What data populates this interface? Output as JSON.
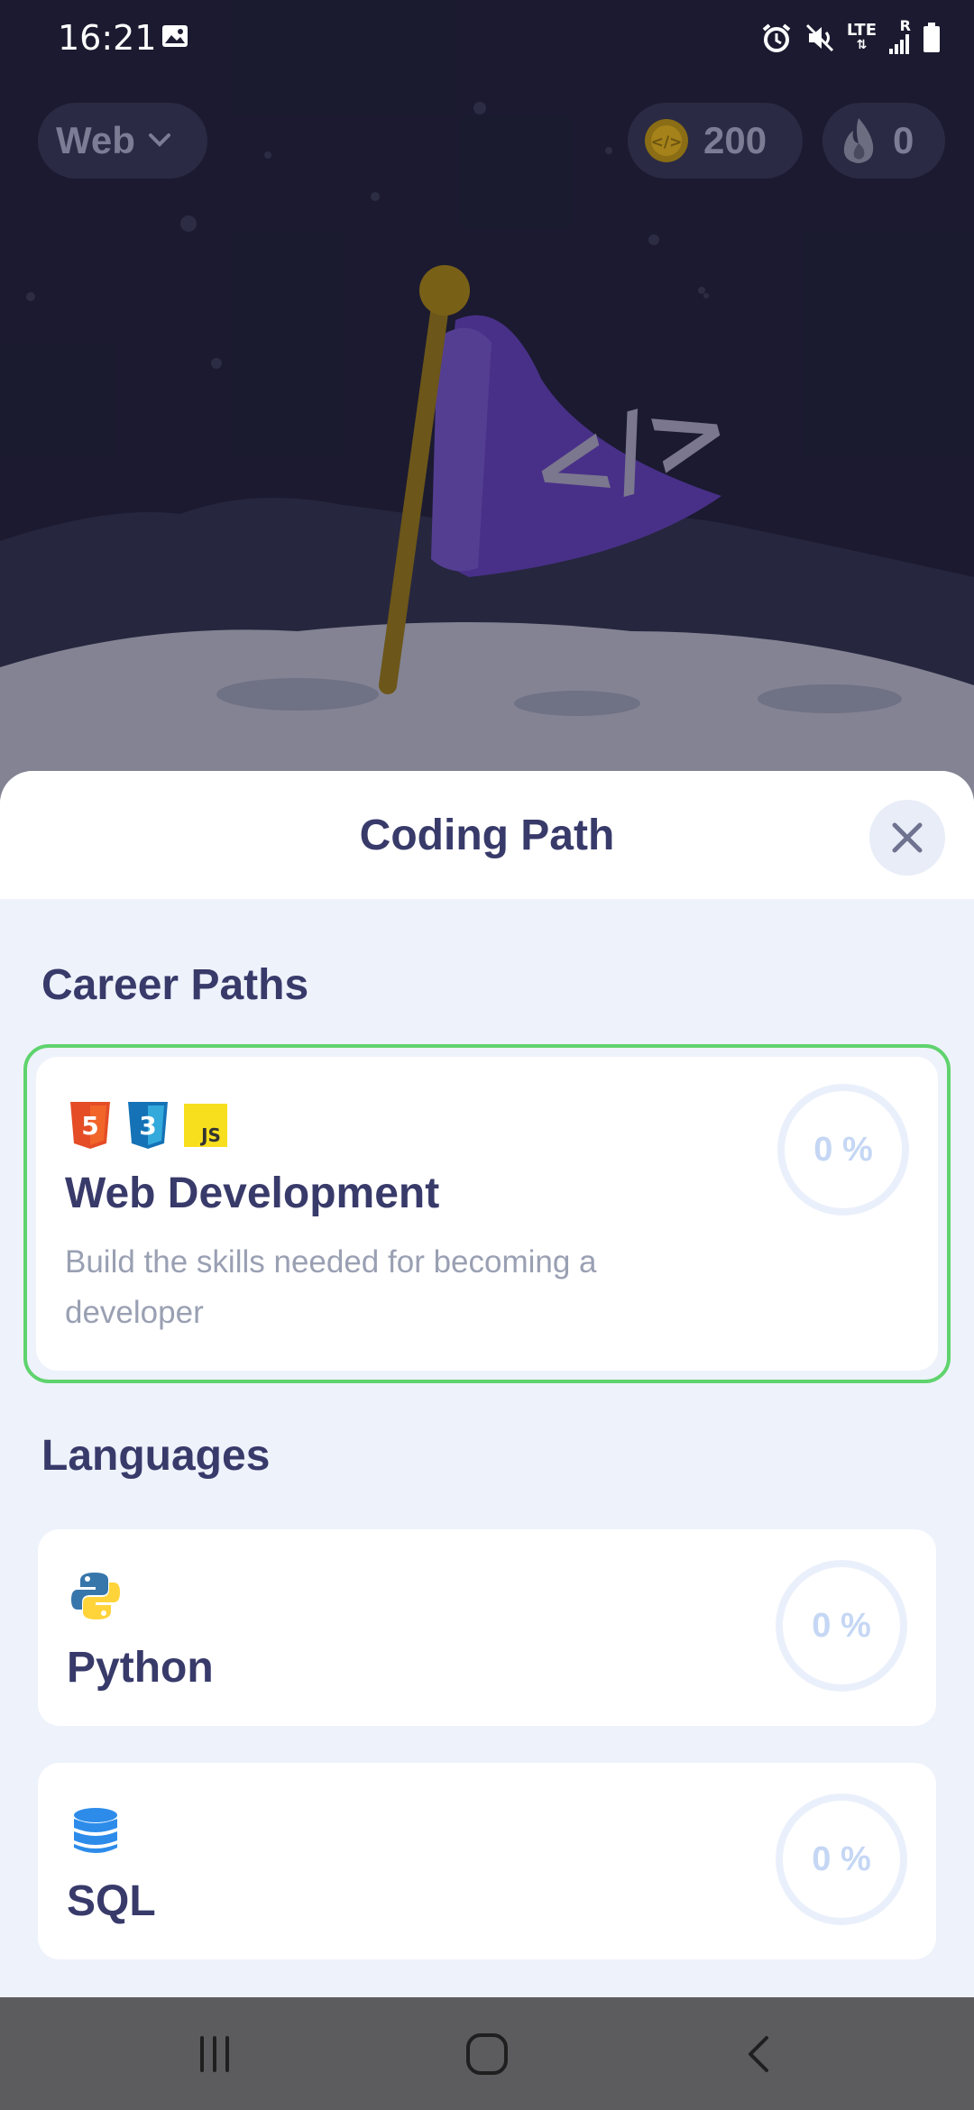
{
  "status_bar": {
    "time": "16:21",
    "network_label": "LTE",
    "roaming_label": "R"
  },
  "header": {
    "course_label": "Web",
    "coins": "200",
    "streak": "0"
  },
  "sheet": {
    "title": "Coding Path",
    "sections": {
      "career_title": "Career Paths",
      "languages_title": "Languages"
    },
    "career_paths": [
      {
        "title": "Web Development",
        "description": "Build the skills needed for becoming a developer",
        "progress": "0 %",
        "icons": [
          "html5-icon",
          "css3-icon",
          "javascript-icon"
        ],
        "selected": true
      }
    ],
    "languages": [
      {
        "title": "Python",
        "progress": "0 %",
        "icon": "python-icon"
      },
      {
        "title": "SQL",
        "progress": "0 %",
        "icon": "database-icon"
      }
    ]
  },
  "colors": {
    "accent_selected": "#5fd36d",
    "title_text": "#383a6a",
    "sheet_bg": "#eef2fb",
    "hero_bg": "#1e1d33",
    "flag": "#5a3aa8"
  }
}
